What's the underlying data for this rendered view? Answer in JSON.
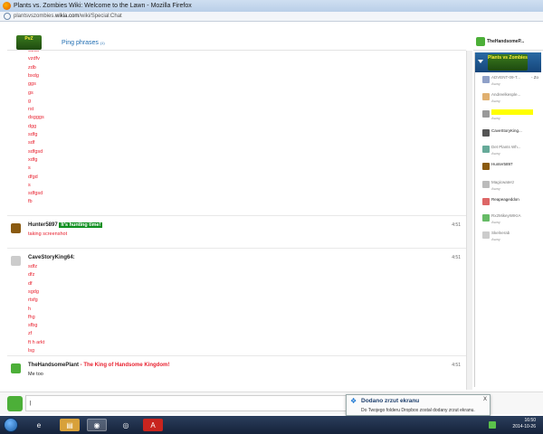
{
  "window": {
    "title": "Plants vs. Zombies Wiki: Welcome to the Lawn - Mozilla Firefox",
    "url_prefix": "plantsvszombies.",
    "url_domain": "wikia.com",
    "url_path": "/wiki/Special:Chat"
  },
  "header": {
    "ping_label": "Ping phrases",
    "ping_count": "(1)"
  },
  "current_user": {
    "name": "TheHandsomeP..."
  },
  "chat": {
    "spam_lines": [
      "wzdv",
      "vzdfv",
      "zdb",
      "bxdg",
      "ggs",
      "gs",
      "g",
      "rst",
      "dsgggs",
      "dgg",
      "sdfg",
      "sdf",
      "sdfgsd",
      "xdfg",
      "s",
      "dfgd",
      "s",
      "sdfgsd",
      "fb"
    ],
    "messages": [
      {
        "user": "Hunter5897",
        "badge": "It's hunting time!",
        "time": "4:51",
        "lines": [
          "taking screenshot"
        ]
      },
      {
        "user": "CaveStoryKing64:",
        "time": "4:51",
        "lines": [
          "sdfz",
          "dfz",
          "df",
          "sgdg",
          "rtsfg",
          "h",
          "fhg",
          "sfbg",
          "zf",
          "ft h arkt",
          "lsg"
        ]
      },
      {
        "user": "TheHandsomePlant",
        "tagline": " - The King of Handsome Kingdom!",
        "time": "4:51",
        "lines": [
          "Me too"
        ]
      }
    ]
  },
  "sidebar": {
    "users": [
      {
        "name": "ADVENT-09-T...",
        "extra": "- Zo",
        "status": "Away"
      },
      {
        "name": "Andreelkesple...",
        "status": "Away"
      },
      {
        "name": "",
        "status": "Away",
        "highlight": "#ffff00"
      },
      {
        "name": "CaveStoryKing...",
        "status": ""
      },
      {
        "name": "Det Plants Wh...",
        "status": "Away"
      },
      {
        "name": "Hunter5897",
        "status": ""
      },
      {
        "name": "Magicwaterz",
        "status": "Away"
      },
      {
        "name": "Reapeageddon",
        "status": ""
      },
      {
        "name": "Rx2MikeyWIKIA",
        "status": "Away"
      },
      {
        "name": "Skelnerab",
        "status": "Away"
      }
    ]
  },
  "input": {
    "value": "|"
  },
  "notification": {
    "title": "Dodano zrzut ekranu",
    "body": "Do Twojego folderu Dropbox został dodany zrzut ekranu.",
    "close": "X"
  },
  "taskbar": {
    "time": "16:50",
    "date": "2014-10-26"
  },
  "colors": {
    "chat_text": "#e8202e",
    "badge_green": "#0d8f1e",
    "link_blue": "#1f6db2"
  }
}
